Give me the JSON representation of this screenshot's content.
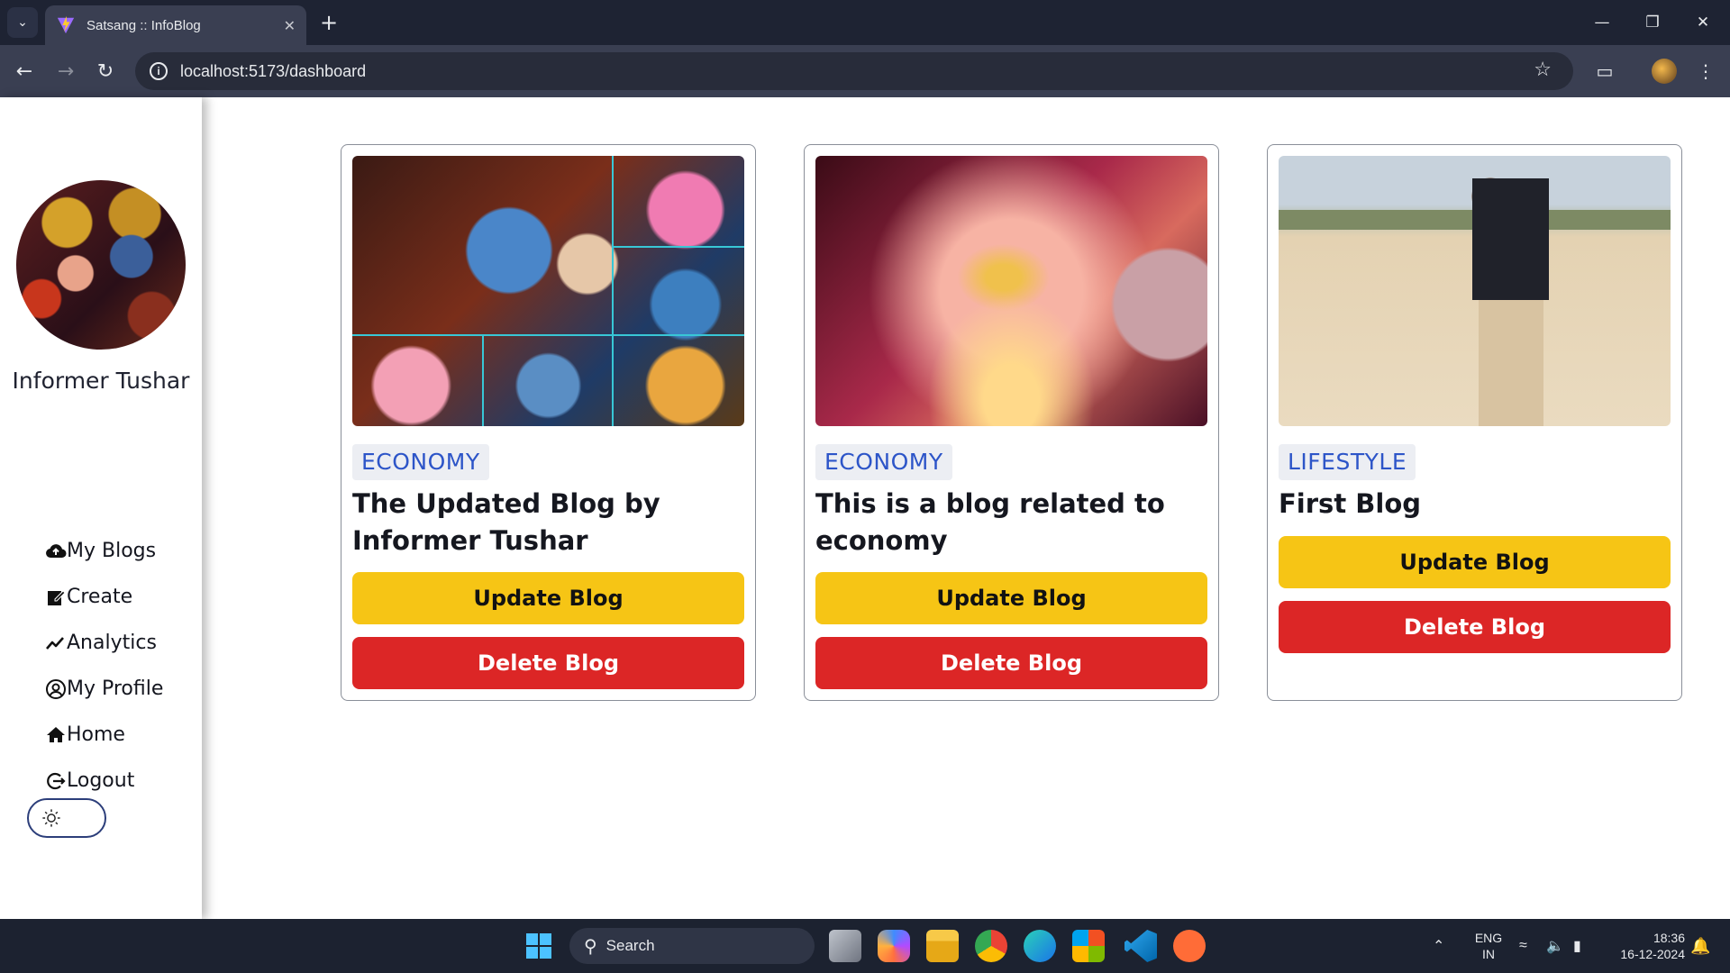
{
  "browser": {
    "tab_title": "Satsang :: InfoBlog",
    "url": "localhost:5173/dashboard"
  },
  "sidebar": {
    "username": "Informer Tushar",
    "items": [
      {
        "label": "My Blogs",
        "icon": "cloud-upload-icon"
      },
      {
        "label": "Create",
        "icon": "edit-icon"
      },
      {
        "label": "Analytics",
        "icon": "analytics-icon"
      },
      {
        "label": "My Profile",
        "icon": "user-circle-icon"
      },
      {
        "label": "Home",
        "icon": "home-icon"
      },
      {
        "label": "Logout",
        "icon": "logout-icon"
      }
    ],
    "theme_icon": "sun-icon"
  },
  "blogs": [
    {
      "category": "ECONOMY",
      "title": "The Updated Blog by Informer Tushar",
      "update_label": "Update Blog",
      "delete_label": "Delete Blog"
    },
    {
      "category": "ECONOMY",
      "title": "This is a blog related to economy",
      "update_label": "Update Blog",
      "delete_label": "Delete Blog"
    },
    {
      "category": "LIFESTYLE",
      "title": "First Blog",
      "update_label": "Update Blog",
      "delete_label": "Delete Blog"
    }
  ],
  "taskbar": {
    "search_label": "Search",
    "lang_top": "ENG",
    "lang_bottom": "IN",
    "time": "18:36",
    "date": "16-12-2024"
  },
  "colors": {
    "update": "#f6c515",
    "delete": "#dc2626",
    "category_text": "#2d55c8"
  }
}
